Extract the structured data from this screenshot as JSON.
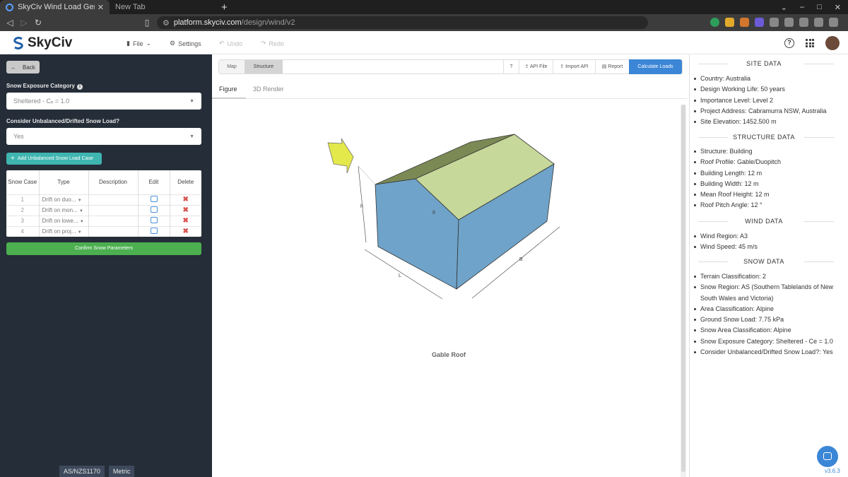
{
  "browser": {
    "tabs": [
      {
        "title": "SkyCiv Wind Load Generat"
      },
      {
        "title": "New Tab"
      }
    ],
    "url_host": "platform.skyciv.com",
    "url_path": "/design/wind/v2"
  },
  "header": {
    "logo": "SkyCiv",
    "menu": {
      "file": "File",
      "settings": "Settings",
      "undo": "Undo",
      "redo": "Redo"
    }
  },
  "left": {
    "back_label": "Back",
    "exposure_label": "Snow Exposure Category",
    "exposure_value": "Sheltered - Cₑ = 1.0",
    "unbalanced_label": "Consider Unbalanced/Drifted Snow Load?",
    "unbalanced_value": "Yes",
    "add_button": "Add Unbalanced Snow Load Case",
    "table": {
      "headers": {
        "case": "Snow Case",
        "type": "Type",
        "description": "Description",
        "edit": "Edit",
        "delete": "Delete"
      },
      "rows": [
        {
          "case": "1",
          "type": "Drift on duo...",
          "description": ""
        },
        {
          "case": "2",
          "type": "Drift on mon...",
          "description": ""
        },
        {
          "case": "3",
          "type": "Drift on lowe...",
          "description": ""
        },
        {
          "case": "4",
          "type": "Drift on proj...",
          "description": ""
        }
      ]
    },
    "confirm_button": "Confirm Snow Parameters",
    "footer": {
      "code": "AS/NZS1170",
      "units": "Metric"
    }
  },
  "center": {
    "toolbar": {
      "map": "Map",
      "structure": "Structure",
      "help": "?",
      "api_file": "API File",
      "import_api": "Import API",
      "report": "Report",
      "calculate": "Calculate Loads"
    },
    "subtabs": {
      "figure": "Figure",
      "render": "3D Render"
    },
    "figure_labels": {
      "h": "h",
      "theta": "θ",
      "l": "L",
      "b": "B"
    },
    "caption": "Gable Roof",
    "colors": {
      "wall": "#6fa3c9",
      "roof": "#c6d89a",
      "roof_dark": "#7b8a55",
      "arrow": "#e3e84b"
    }
  },
  "right": {
    "site_title": "SITE DATA",
    "site": [
      "Country: Australia",
      "Design Working Life: 50 years",
      "Importance Level: Level 2",
      "Project Address: Cabramurra NSW, Australia",
      "Site Elevation: 1452.500 m"
    ],
    "structure_title": "STRUCTURE DATA",
    "structure": [
      "Structure: Building",
      "Roof Profile: Gable/Duopitch",
      "Building Length: 12 m",
      "Building Width: 12 m",
      "Mean Roof Height: 12 m",
      "Roof Pitch Angle: 12 °"
    ],
    "wind_title": "WIND DATA",
    "wind": [
      "Wind Region: A3",
      "Wind Speed: 45 m/s"
    ],
    "snow_title": "SNOW DATA",
    "snow": [
      "Terrain Classification: 2",
      "Snow Region: AS (Southern Tablelands of New South Wales and Victoria)",
      "Area Classification: Alpine",
      "Ground Snow Load: 7.75 kPa",
      "Snow Area Classification: Alpine",
      "Snow Exposure Category: Sheltered - Ce = 1.0",
      "Consider Unbalanced/Drifted Snow Load?: Yes"
    ],
    "version": "v3.6.3"
  }
}
